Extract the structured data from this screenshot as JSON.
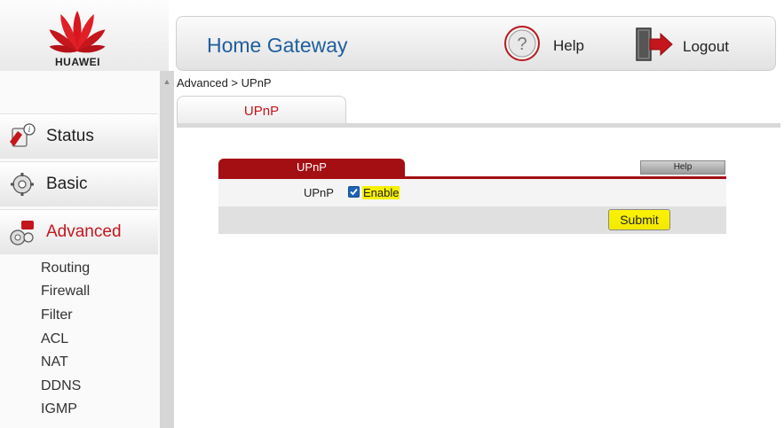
{
  "brand": {
    "name": "HUAWEI",
    "color": "#c4161c"
  },
  "header": {
    "title": "Home Gateway",
    "help_label": "Help",
    "logout_label": "Logout"
  },
  "sidebar": {
    "items": [
      {
        "label": "Status",
        "icon": "status-icon"
      },
      {
        "label": "Basic",
        "icon": "basic-icon"
      },
      {
        "label": "Advanced",
        "icon": "advanced-icon",
        "active": true
      }
    ],
    "submenu": [
      "Routing",
      "Firewall",
      "Filter",
      "ACL",
      "NAT",
      "DDNS",
      "IGMP"
    ]
  },
  "breadcrumb": "Advanced > UPnP",
  "tab": {
    "label": "UPnP"
  },
  "panel": {
    "title": "UPnP",
    "help_label": "Help",
    "field_label": "UPnP",
    "checkbox_label": "Enable",
    "checkbox_checked": true,
    "submit_label": "Submit"
  },
  "colors": {
    "accent_red": "#a40f14",
    "title_blue": "#1f5fa0",
    "highlight_yellow": "#f5ef00"
  }
}
